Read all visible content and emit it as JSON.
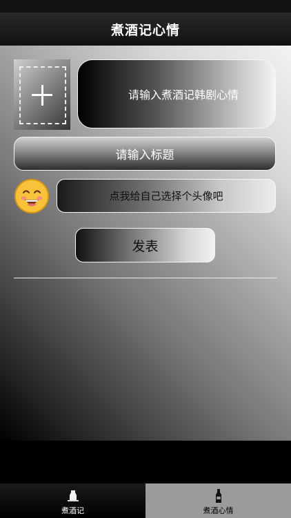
{
  "nav": {
    "title": "煮酒记心情"
  },
  "form": {
    "mood_placeholder": "请输入煮酒记韩剧心情",
    "title_placeholder": "请输入标题",
    "avatar_button_label": "点我给自己选择个头像吧",
    "publish_label": "发表"
  },
  "tabs": [
    {
      "label": "煮酒记",
      "icon": "bottle-icon"
    },
    {
      "label": "煮酒心情",
      "icon": "wine-bottle-icon"
    }
  ]
}
